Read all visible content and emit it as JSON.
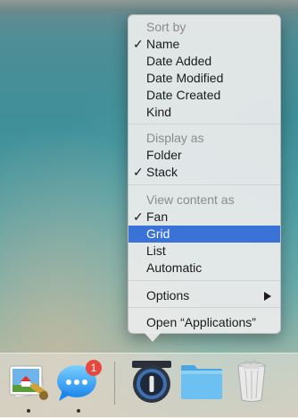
{
  "menu": {
    "sort_by_header": "Sort by",
    "sort_options": [
      "Name",
      "Date Added",
      "Date Modified",
      "Date Created",
      "Kind"
    ],
    "display_as_header": "Display as",
    "display_options": [
      "Folder",
      "Stack"
    ],
    "view_content_header": "View content as",
    "view_options": [
      "Fan",
      "Grid",
      "List",
      "Automatic"
    ],
    "options_label": "Options",
    "open_label": "Open “Applications”",
    "checked": {
      "sort": "Name",
      "display": "Stack",
      "view": "Fan"
    },
    "highlighted": "Grid",
    "checkmark": "✓"
  },
  "dock": {
    "apps": [
      {
        "name": "Preview",
        "icon": "preview-app-icon",
        "running": true
      },
      {
        "name": "Messages",
        "icon": "messages-app-icon",
        "running": true,
        "badge": "1"
      },
      {
        "name": "1Password",
        "icon": "1password-app-icon",
        "running": false
      },
      {
        "name": "Applications",
        "icon": "applications-folder-icon",
        "running": false
      },
      {
        "name": "Trash",
        "icon": "trash-icon",
        "running": false
      }
    ]
  },
  "colors": {
    "highlight": "#3a72d8",
    "badge": "#e8473d"
  }
}
